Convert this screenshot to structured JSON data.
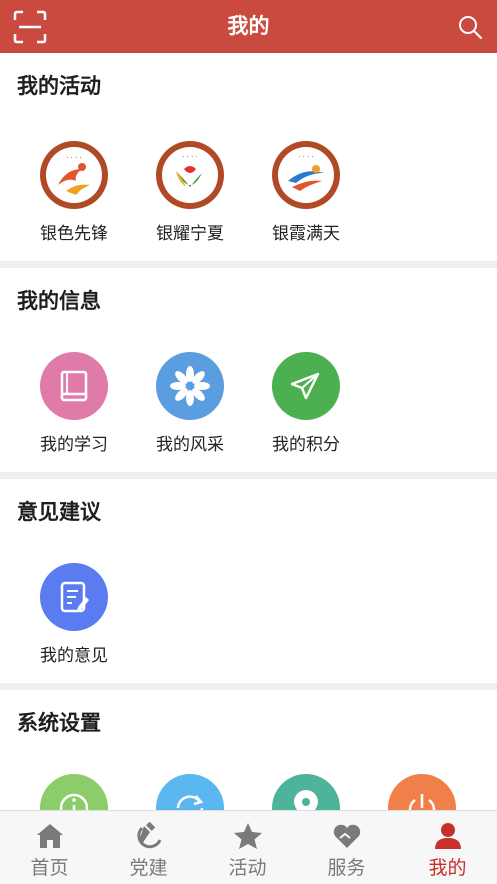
{
  "header": {
    "title": "我的"
  },
  "sections": {
    "activities": {
      "title": "我的活动",
      "items": [
        {
          "label": "银色先锋",
          "icon": "silver-pioneer-logo-icon"
        },
        {
          "label": "银耀宁夏",
          "icon": "silver-ningxia-logo-icon"
        },
        {
          "label": "银霞满天",
          "icon": "silver-sky-logo-icon"
        }
      ]
    },
    "info": {
      "title": "我的信息",
      "items": [
        {
          "label": "我的学习",
          "icon": "book-icon",
          "color": "#e07aa8"
        },
        {
          "label": "我的风采",
          "icon": "flower-icon",
          "color": "#5b9ee0"
        },
        {
          "label": "我的积分",
          "icon": "paper-plane-icon",
          "color": "#4caf50"
        }
      ]
    },
    "feedback": {
      "title": "意见建议",
      "items": [
        {
          "label": "我的意见",
          "icon": "edit-note-icon",
          "color": "#5a7cf0"
        }
      ]
    },
    "settings": {
      "title": "系统设置",
      "items": [
        {
          "icon": "info-icon",
          "color": "#8ccc6a"
        },
        {
          "icon": "refresh-icon",
          "color": "#5ab7f0"
        },
        {
          "icon": "location-icon",
          "color": "#4db39a"
        },
        {
          "icon": "power-icon",
          "color": "#f0804a"
        }
      ]
    }
  },
  "tabbar": {
    "tabs": [
      {
        "label": "首页",
        "icon": "home-icon"
      },
      {
        "label": "党建",
        "icon": "hammer-sickle-icon"
      },
      {
        "label": "活动",
        "icon": "star-icon"
      },
      {
        "label": "服务",
        "icon": "heart-hands-icon"
      },
      {
        "label": "我的",
        "icon": "user-icon",
        "active": true
      }
    ],
    "active_color": "#c9302c",
    "inactive_color": "#7a7a7a"
  }
}
